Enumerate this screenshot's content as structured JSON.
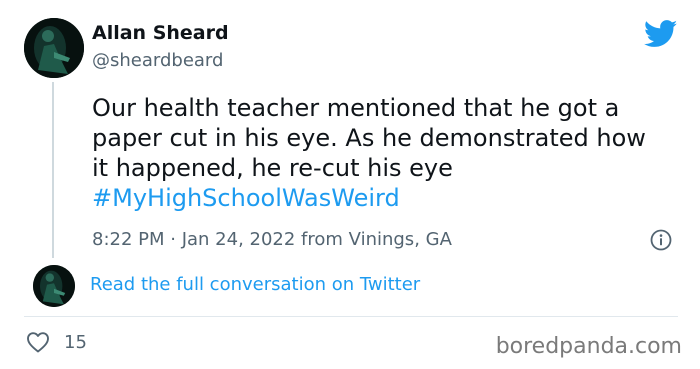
{
  "author": {
    "name": "Allan Sheard",
    "handle": "@sheardbeard"
  },
  "tweet": {
    "lines": [
      "Our health teacher mentioned that he got a",
      "paper cut in his eye. As he demonstrated how",
      "it happened, he re-cut his eye"
    ],
    "hashtag": "#MyHighSchoolWasWeird",
    "timestamp": "8:22 PM · Jan 24, 2022 from Vinings, GA"
  },
  "read_conversation_link": "Read the full conversation on Twitter",
  "likes": "15",
  "watermark": "boredpanda.com",
  "icons": {
    "brand": "twitter-bird-icon",
    "info": "info-icon",
    "like": "heart-icon"
  },
  "colors": {
    "accent": "#1d9bf0",
    "text": "#0f1419",
    "muted": "#536471",
    "divider": "#e1e8ed"
  }
}
